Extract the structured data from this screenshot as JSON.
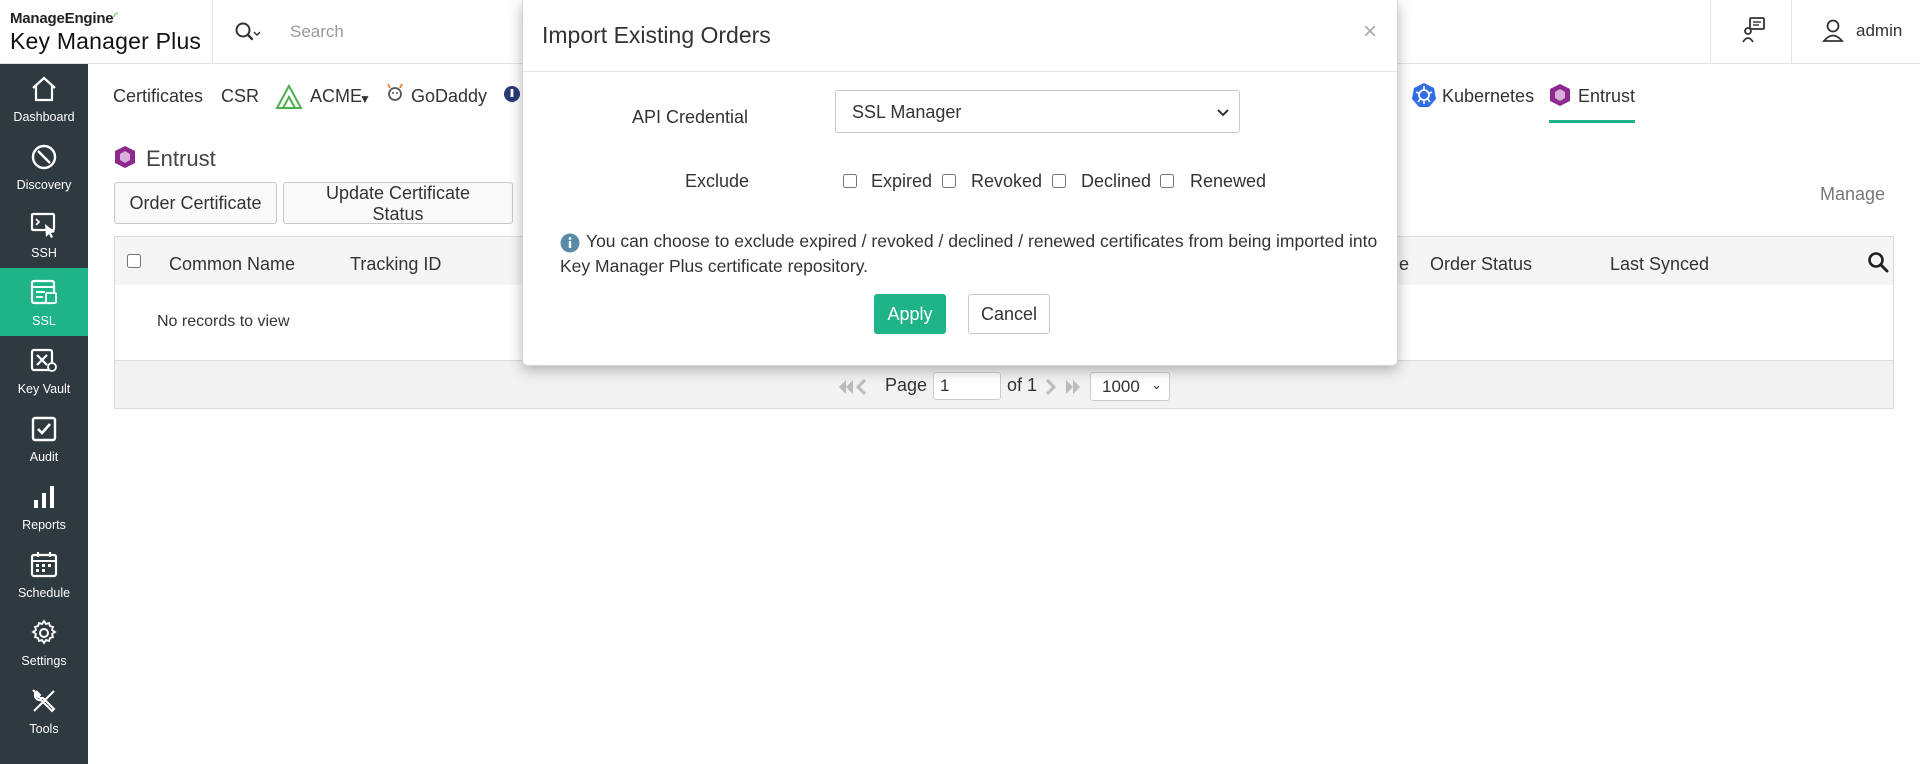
{
  "header": {
    "brand": "ManageEngine",
    "product": "Key Manager Plus",
    "search_placeholder": "Search",
    "user": "admin"
  },
  "sidebar": {
    "items": [
      {
        "label": "Dashboard",
        "icon": "home-icon",
        "active": false
      },
      {
        "label": "Discovery",
        "icon": "discovery-icon",
        "active": false
      },
      {
        "label": "SSH",
        "icon": "ssh-icon",
        "active": false
      },
      {
        "label": "SSL",
        "icon": "ssl-icon",
        "active": true
      },
      {
        "label": "Key Vault",
        "icon": "key-vault-icon",
        "active": false
      },
      {
        "label": "Audit",
        "icon": "audit-icon",
        "active": false
      },
      {
        "label": "Reports",
        "icon": "reports-icon",
        "active": false
      },
      {
        "label": "Schedule",
        "icon": "schedule-icon",
        "active": false
      },
      {
        "label": "Settings",
        "icon": "settings-icon",
        "active": false
      },
      {
        "label": "Tools",
        "icon": "tools-icon",
        "active": false
      }
    ]
  },
  "tabs": {
    "certificates": "Certificates",
    "csr": "CSR",
    "acme": "ACME",
    "godaddy": "GoDaddy",
    "kubernetes": "Kubernetes",
    "entrust": "Entrust",
    "active": "Entrust"
  },
  "page": {
    "title": "Entrust",
    "buttons": {
      "order": "Order Certificate",
      "update_status": "Update Certificate Status"
    },
    "manage": "Manage"
  },
  "grid": {
    "columns": {
      "common_name": "Common Name",
      "tracking_id": "Tracking ID",
      "partial": "ede",
      "order_status": "Order Status",
      "last_synced": "Last Synced"
    },
    "empty_message": "No records to view"
  },
  "pager": {
    "page_label": "Page",
    "page_value": "1",
    "of_label": "of 1",
    "page_size": "1000"
  },
  "modal": {
    "title": "Import Existing Orders",
    "close_symbol": "×",
    "api_credential_label": "API Credential",
    "api_credential_value": "SSL Manager",
    "exclude_label": "Exclude",
    "exclude_options": [
      "Expired",
      "Revoked",
      "Declined",
      "Renewed"
    ],
    "info_text": "You can choose to exclude expired / revoked / declined / renewed certificates from being imported into Key Manager Plus certificate repository.",
    "apply": "Apply",
    "cancel": "Cancel"
  },
  "colors": {
    "accent": "#1fb487",
    "sidebar_bg": "#2e3a3f",
    "entrust_purple": "#8e2a8e",
    "kubernetes_blue": "#326ce5"
  }
}
